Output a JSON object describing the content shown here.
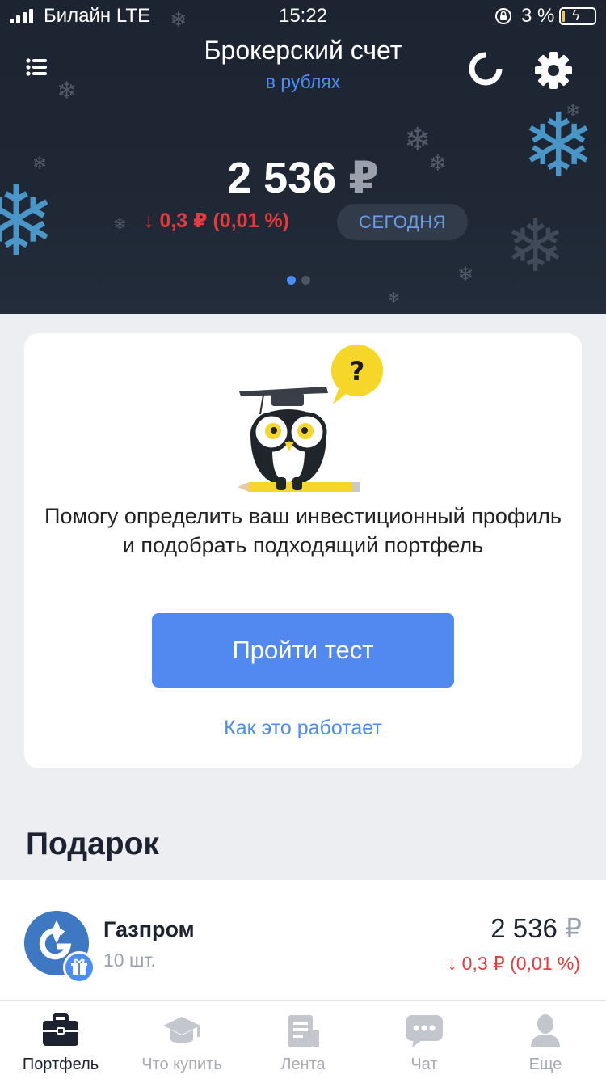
{
  "status_bar": {
    "carrier": "Билайн  LTE",
    "time": "15:22",
    "battery_percent": "3 %",
    "battery_level": 0.03
  },
  "header": {
    "title": "Брокерский счет",
    "subtitle": "в рублях",
    "balance": "2 536",
    "balance_currency": "₽",
    "change": "↓ 0,3 ₽ (0,01 %)",
    "period_label": "СЕГОДНЯ",
    "page_dots": 2,
    "active_dot": 0,
    "icons": {
      "menu": "list-icon",
      "refresh": "refresh-icon",
      "settings": "gear-icon"
    }
  },
  "promo_card": {
    "text": "Помогу определить ваш инвестиционный профиль и подобрать подходящий портфель",
    "button_label": "Пройти тест",
    "link_label": "Как это работает",
    "illustration": "owl-mascot-with-question"
  },
  "gift_section": {
    "title": "Подарок",
    "asset": {
      "name": "Газпром",
      "quantity": "10 шт.",
      "price": "2 536",
      "price_currency": "₽",
      "change": "↓ 0,3 ₽ (0,01 %)"
    }
  },
  "tabbar": {
    "tabs": [
      {
        "label": "Портфель",
        "icon": "briefcase-icon",
        "active": true
      },
      {
        "label": "Что купить",
        "icon": "graduation-cap-icon",
        "active": false
      },
      {
        "label": "Лента",
        "icon": "feed-icon",
        "active": false
      },
      {
        "label": "Чат",
        "icon": "chat-icon",
        "active": false
      },
      {
        "label": "Еще",
        "icon": "person-icon",
        "active": false
      }
    ]
  },
  "colors": {
    "header_bg": "#1f2735",
    "accent": "#4c8cf5",
    "negative": "#e33b3b",
    "button": "#5189f0"
  }
}
